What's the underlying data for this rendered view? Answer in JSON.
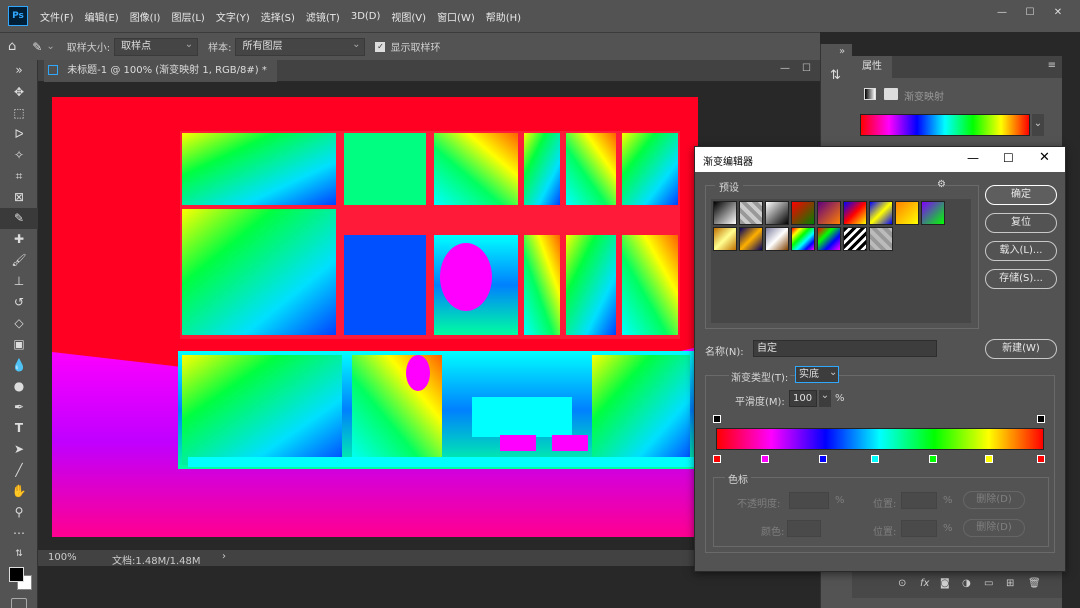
{
  "app": {
    "logo": "Ps",
    "menus": [
      "文件(F)",
      "编辑(E)",
      "图像(I)",
      "图层(L)",
      "文字(Y)",
      "选择(S)",
      "滤镜(T)",
      "3D(D)",
      "视图(V)",
      "窗口(W)",
      "帮助(H)"
    ]
  },
  "window_controls": {
    "minimize": "—",
    "maximize": "☐",
    "close": "✕"
  },
  "options": {
    "sample_size_label": "取样大小:",
    "sample_size_value": "取样点",
    "sample_label": "样本:",
    "sample_value": "所有图层",
    "show_ring_label": "显示取样环"
  },
  "document": {
    "tab_title": "未标题-1 @ 100% (渐变映射 1, RGB/8#) *",
    "zoom": "100%",
    "doc_info": "文档:1.48M/1.48M"
  },
  "properties": {
    "tab": "属性",
    "adjustment_name": "渐变映射"
  },
  "dialog": {
    "title": "渐变编辑器",
    "presets_label": "预设",
    "buttons": {
      "ok": "确定",
      "reset": "复位",
      "load": "载入(L)...",
      "save": "存储(S)...",
      "new": "新建(W)"
    },
    "name_label": "名称(N):",
    "name_value": "自定",
    "gradient_type_label": "渐变类型(T):",
    "gradient_type_value": "实底",
    "smoothness_label": "平滑度(M):",
    "smoothness_value": "100",
    "percent": "%",
    "stops_group_label": "色标",
    "opacity_label": "不透明度:",
    "color_label": "颜色:",
    "location_label": "位置:",
    "delete_label": "删除(D)",
    "gradient_colors": [
      "#ff0000",
      "#ff00ff",
      "#0000ff",
      "#00ffff",
      "#00ff00",
      "#ffff00",
      "#ff0000"
    ]
  },
  "colors": {
    "panel": "#535353",
    "dark": "#424242",
    "canvas_bg": "#ff0020"
  }
}
